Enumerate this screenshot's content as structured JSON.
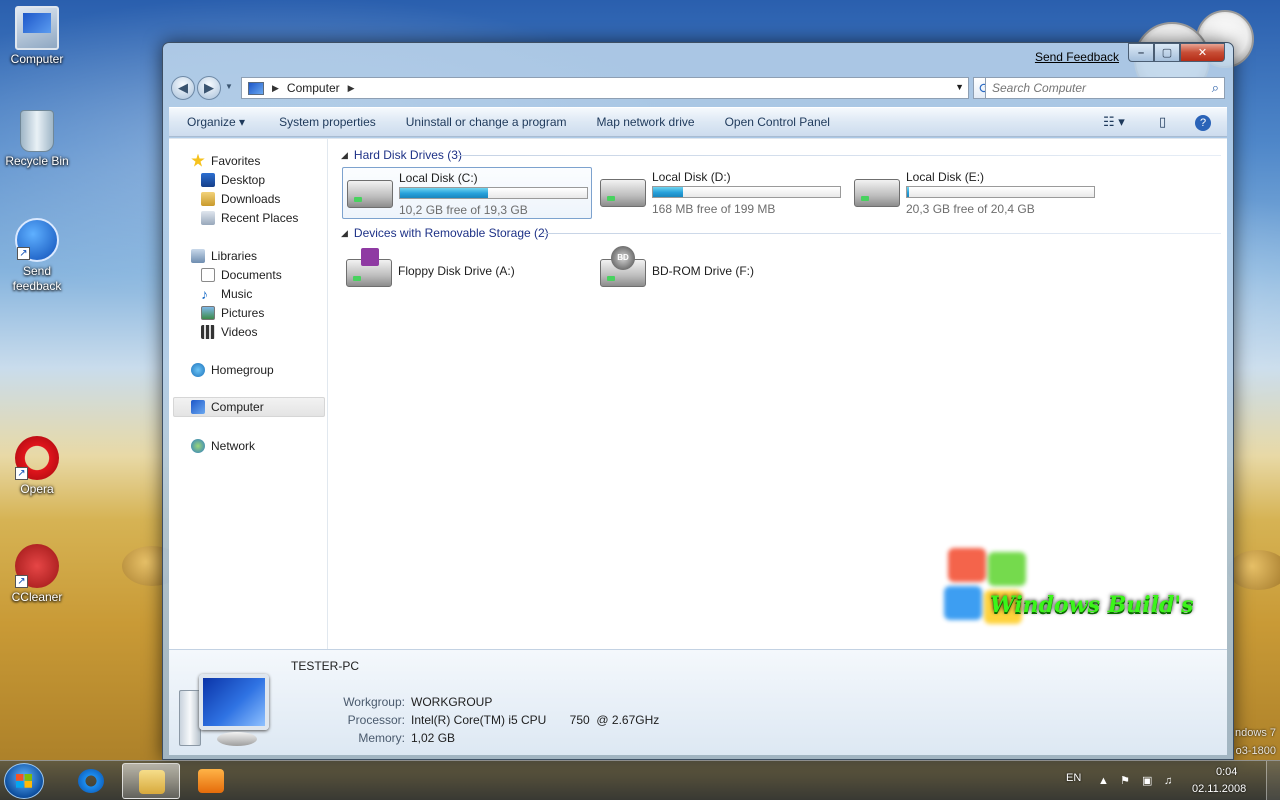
{
  "desktop": {
    "icons": [
      {
        "label": "Computer",
        "icon": "computer-icon"
      },
      {
        "label": "Recycle Bin",
        "icon": "recycle-bin-icon"
      },
      {
        "label": "Send feedback",
        "icon": "feedback-icon"
      },
      {
        "label": "Opera",
        "icon": "opera-icon"
      },
      {
        "label": "CCleaner",
        "icon": "ccleaner-icon"
      }
    ],
    "watermark": {
      "text": "Windows Build's",
      "side_line1": "ndows 7",
      "side_line2": "o3-1800"
    }
  },
  "window": {
    "send_feedback": "Send Feedback",
    "caption": {
      "minimize": "–",
      "maximize": "▢",
      "close": "✕"
    },
    "nav": {
      "back": "◀",
      "forward": "▶",
      "path": "Computer",
      "search_placeholder": "Search Computer"
    },
    "toolbar": {
      "organize": "Organize ▾",
      "system_properties": "System properties",
      "uninstall": "Uninstall or change a program",
      "map_network": "Map network drive",
      "control_panel": "Open Control Panel"
    },
    "navpane": {
      "favorites": "Favorites",
      "desktop": "Desktop",
      "downloads": "Downloads",
      "recent_places": "Recent Places",
      "libraries": "Libraries",
      "documents": "Documents",
      "music": "Music",
      "pictures": "Pictures",
      "videos": "Videos",
      "homegroup": "Homegroup",
      "computer": "Computer",
      "network": "Network"
    },
    "groups": {
      "hard_disks": "Hard Disk Drives (3)",
      "removable": "Devices with Removable Storage (2)"
    },
    "drives": [
      {
        "name": "Local Disk (C:)",
        "free": "10,2 GB free of 19,3 GB",
        "used_fraction": 0.47
      },
      {
        "name": "Local Disk (D:)",
        "free": "168 MB free of 199 MB",
        "used_fraction": 0.16
      },
      {
        "name": "Local Disk (E:)",
        "free": "20,3 GB free of 20,4 GB",
        "used_fraction": 0.01
      }
    ],
    "removable": [
      {
        "name": "Floppy Disk Drive (A:)"
      },
      {
        "name": "BD-ROM Drive (F:)"
      }
    ],
    "details": {
      "pc_name": "TESTER-PC",
      "workgroup_label": "Workgroup:",
      "workgroup": "WORKGROUP",
      "processor_label": "Processor:",
      "processor": "Intel(R) Core(TM) i5 CPU       750  @ 2.67GHz",
      "memory_label": "Memory:",
      "memory": "1,02 GB"
    }
  },
  "taskbar": {
    "language": "EN",
    "time": "0:04",
    "date": "02.11.2008"
  }
}
